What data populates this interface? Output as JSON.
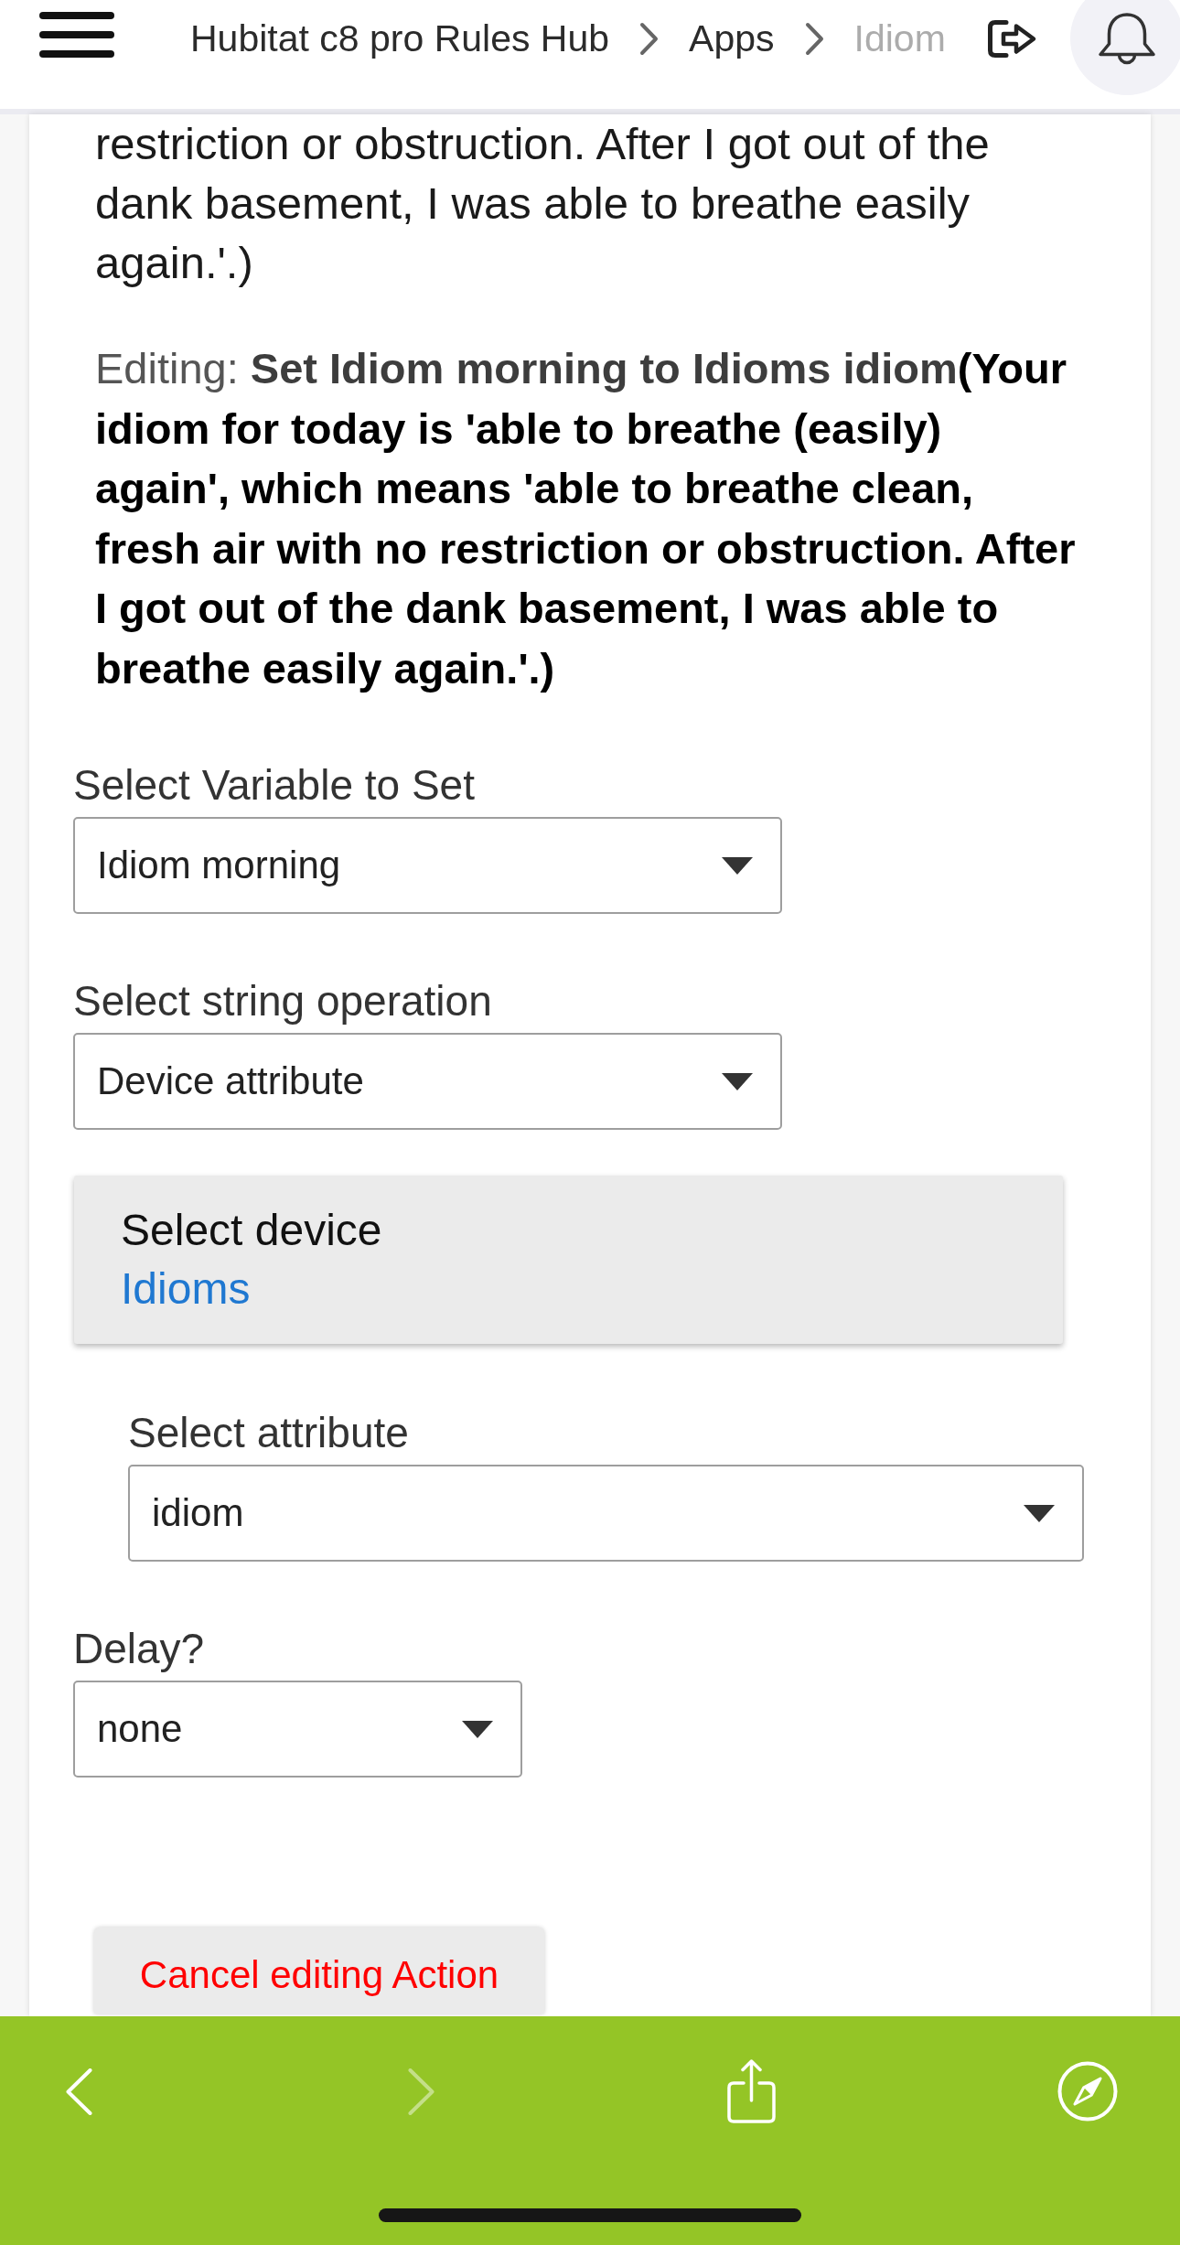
{
  "header": {
    "breadcrumbs": [
      {
        "label": "Hubitat c8 pro Rules Hub",
        "current": false
      },
      {
        "label": "Apps",
        "current": false
      },
      {
        "label": "Idiom",
        "current": true
      }
    ]
  },
  "content": {
    "top_text": "restriction or obstruction. After I got out of the dank basement, I was able to breathe easily again.'.)",
    "editing": {
      "prefix": "Editing:",
      "action": "Set Idiom morning to Idioms idiom",
      "detail": "(Your idiom for today is 'able to breathe (easily) again', which means 'able to breathe clean, fresh air with no restriction or obstruction. After I got out of the dank basement, I was able to breathe easily again.'.)"
    },
    "fields": [
      {
        "kind": "select",
        "label": "Select Variable to Set",
        "value": "Idiom morning"
      },
      {
        "kind": "select",
        "label": "Select string operation",
        "value": "Device attribute"
      },
      {
        "kind": "device",
        "label": "Select device",
        "value": "Idioms",
        "children": [
          {
            "kind": "select",
            "label": "Select attribute",
            "value": "idiom"
          }
        ]
      },
      {
        "kind": "select",
        "label": "Delay?",
        "value": "none"
      }
    ],
    "cancel_button": {
      "label": "Cancel editing Action"
    }
  },
  "nav_bar": {
    "buttons": [
      {
        "kind": "back",
        "disabled": false
      },
      {
        "kind": "forward",
        "disabled": true
      },
      {
        "kind": "share",
        "disabled": false
      },
      {
        "kind": "compass",
        "disabled": false
      }
    ]
  }
}
